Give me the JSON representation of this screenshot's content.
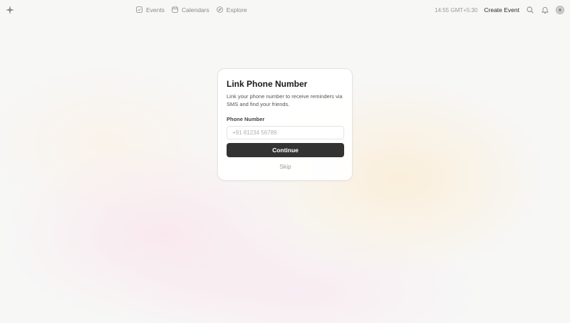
{
  "header": {
    "logo_icon": "sparkle-icon",
    "nav": [
      {
        "label": "Events",
        "icon": "events-icon"
      },
      {
        "label": "Calendars",
        "icon": "calendar-icon"
      },
      {
        "label": "Explore",
        "icon": "compass-icon"
      }
    ],
    "time": "14:55 GMT+5:30",
    "create_event_label": "Create Event",
    "search_icon": "search-icon",
    "bell_icon": "bell-icon",
    "avatar_icon": "avatar-icon"
  },
  "dialog": {
    "title": "Link Phone Number",
    "description": "Link your phone number to receive reminders via SMS and find your friends.",
    "phone_label": "Phone Number",
    "phone_value": "",
    "phone_placeholder": "+91 81234 56789",
    "continue_label": "Continue",
    "skip_label": "Skip"
  },
  "colors": {
    "primary_button": "#333333",
    "muted_text": "#8a8a8a"
  }
}
